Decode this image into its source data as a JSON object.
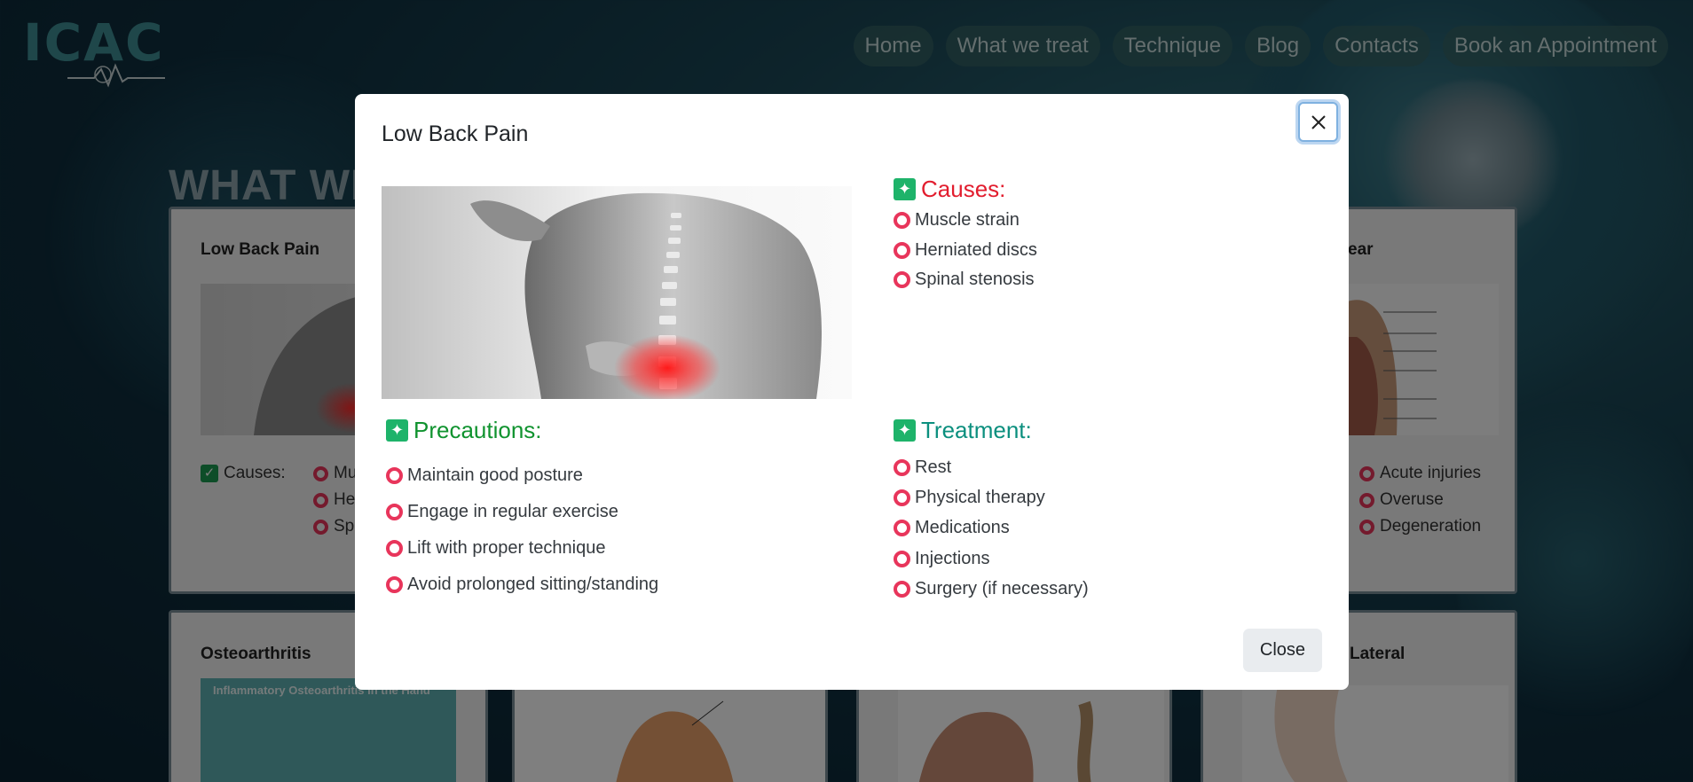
{
  "site": {
    "logo_text": "ICAC",
    "nav": [
      "Home",
      "What we treat",
      "Technique",
      "Blog",
      "Contacts",
      "Book an Appointment"
    ],
    "page_heading": "WHAT WE",
    "cards": [
      {
        "title": "Low Back Pain",
        "causes_label": "Causes:",
        "causes": [
          "Mu",
          "He",
          "Sp"
        ]
      },
      {
        "title": "ear",
        "causes": [
          "Acute injuries",
          "Overuse",
          "Degeneration"
        ]
      },
      {
        "title": "Osteoarthritis",
        "image_caption": "Inflammatory Osteoarthritis in the Hand"
      },
      {
        "title": "Lateral"
      }
    ]
  },
  "modal": {
    "title": "Low Back Pain",
    "causes": {
      "heading": "Causes:",
      "items": [
        "Muscle strain",
        "Herniated discs",
        "Spinal stenosis"
      ]
    },
    "precautions": {
      "heading": "Precautions:",
      "items": [
        "Maintain good posture",
        "Engage in regular exercise",
        "Lift with proper technique",
        "Avoid prolonged sitting/standing"
      ]
    },
    "treatment": {
      "heading": "Treatment:",
      "items": [
        "Rest",
        "Physical therapy",
        "Medications",
        "Injections",
        "Surgery (if necessary)"
      ]
    },
    "close_label": "Close"
  },
  "colors": {
    "causes": "#e21d2e",
    "precautions": "#10932f",
    "treatment": "#0b8f7e",
    "bullet_ring": "#e8355b",
    "sparkle_badge": "#1eb36a"
  },
  "icons": {
    "close": "close-icon",
    "section": "sparkle-icon",
    "bullet": "ring-bullet-icon",
    "check": "checkbox-icon"
  }
}
